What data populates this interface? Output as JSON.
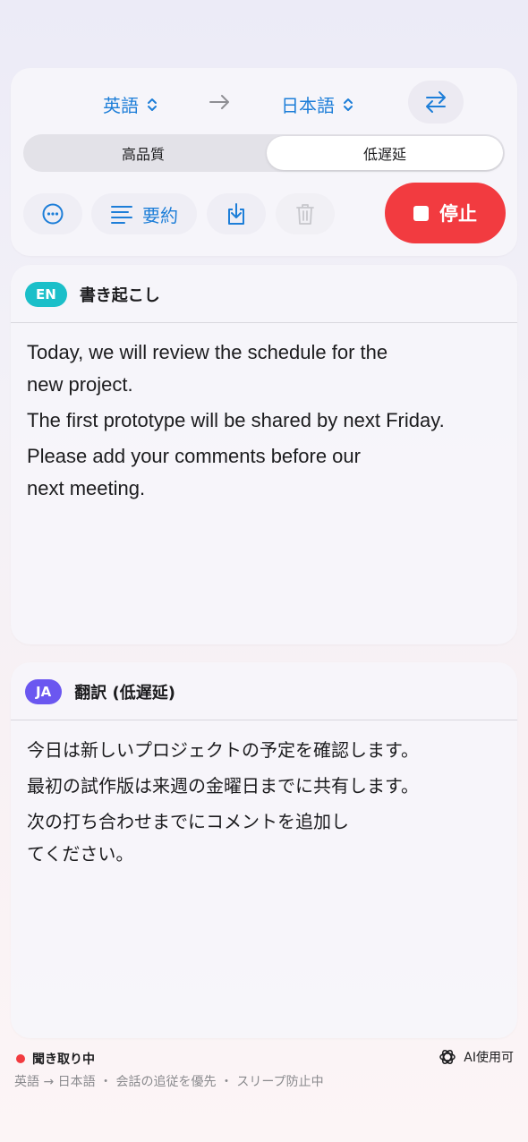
{
  "language_bar": {
    "source_lang": "英語",
    "arrow": "→",
    "target_lang": "日本語"
  },
  "quality_segment": {
    "options": [
      "高品質",
      "低遅延"
    ],
    "selected": "低遅延"
  },
  "toolbar": {
    "summary_label": "要約",
    "stop_label": "停止"
  },
  "transcription": {
    "badge": "EN",
    "title": "書き起こし",
    "lines": [
      "Today, we will review the schedule for the\nnew project.",
      "The first prototype will be shared by next Friday.",
      "Please add your comments before our\nnext meeting."
    ]
  },
  "translation": {
    "badge": "JA",
    "title": "翻訳 (低遅延)",
    "lines": [
      "今日は新しいプロジェクトの予定を確認します。",
      "最初の試作版は来週の金曜日までに共有します。",
      "次の打ち合わせまでにコメントを追加し\nてください。"
    ]
  },
  "status": {
    "listening": "聞き取り中",
    "ai": "AI使用可",
    "detail": "英語 → 日本語 ・ 会話の追従を優先 ・ スリープ防止中"
  },
  "colors": {
    "accent": "#1d7ed8",
    "stop": "#f23b40",
    "en_badge": "#1bbfc9",
    "ja_badge": "#6b57f0"
  },
  "icons": [
    "chevron-updown-icon",
    "arrow-right-icon",
    "swap-arrows-icon",
    "ellipsis-icon",
    "summary-lines-icon",
    "download-icon",
    "trash-icon",
    "stop-square-icon",
    "ai-sparkle-icon"
  ]
}
